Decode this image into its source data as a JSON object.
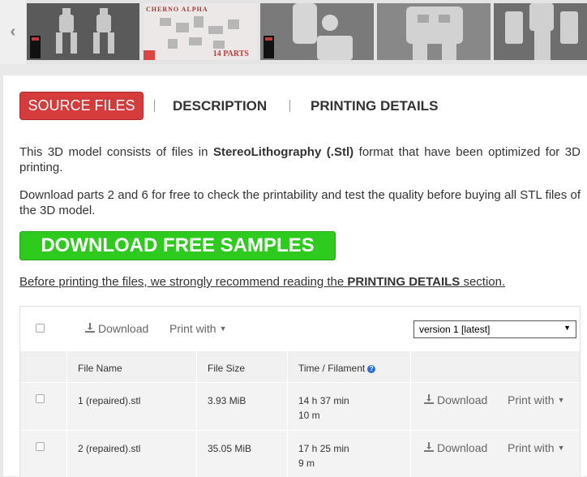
{
  "gallery": {
    "prev_icon": "chevron-left-icon",
    "thumb2_caption": "CHERNO ALPHA",
    "thumb2_parts": "14 PARTS"
  },
  "tabs": [
    {
      "label": "SOURCE FILES",
      "active": true
    },
    {
      "label": "DESCRIPTION",
      "active": false
    },
    {
      "label": "PRINTING DETAILS",
      "active": false
    }
  ],
  "intro": {
    "p1_before": "This 3D model consists of files in ",
    "p1_bold": "StereoLithography (.Stl)",
    "p1_after": " format that have been optimized for 3D printing.",
    "p2": "Download parts 2 and 6 for free to check the printability and test the quality before buying all STL files of the 3D model."
  },
  "download_samples_label": "DOWNLOAD FREE SAMPLES",
  "recommend": {
    "before": "Before printing the files, we strongly recommend reading the ",
    "bold": "PRINTING DETAILS",
    "after": " section."
  },
  "toolbar": {
    "download_label": "Download",
    "print_with_label": "Print with",
    "version_selected": "version 1 [latest]"
  },
  "table": {
    "headers": {
      "file_name": "File Name",
      "file_size": "File Size",
      "time_filament": "Time / Filament"
    },
    "rows": [
      {
        "name": "1 (repaired).stl",
        "size": "3.93 MiB",
        "time": "14 h 37 min",
        "filament": "10 m",
        "download": "Download",
        "print_with": "Print with"
      },
      {
        "name": "2 (repaired).stl",
        "size": "35.05 MiB",
        "time": "17 h 25 min",
        "filament": "9 m",
        "download": "Download",
        "print_with": "Print with"
      }
    ]
  },
  "colors": {
    "accent_red": "#d43b3b",
    "accent_green": "#2ecb1e",
    "help_blue": "#2a6fdb"
  }
}
